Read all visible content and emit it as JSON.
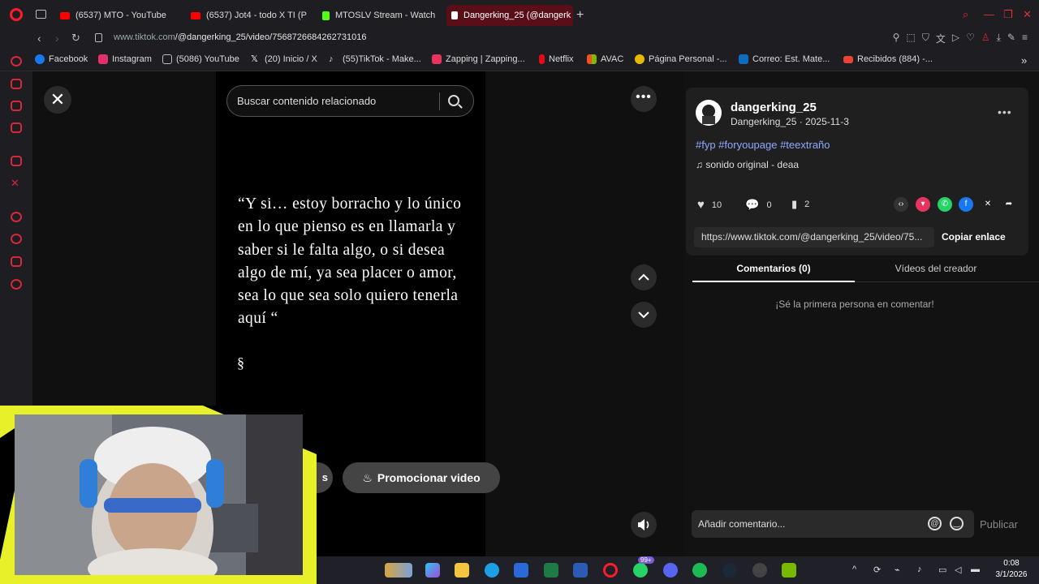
{
  "browser": {
    "tabs": [
      {
        "label": "(6537) MTO - YouTube",
        "color": "#ff0000"
      },
      {
        "label": "(6537) Jot4 - todo X TI (P",
        "color": "#ff0000"
      },
      {
        "label": "MTOSLV Stream - Watch L",
        "color": "#53fc18"
      },
      {
        "label": "Dangerking_25 (@dangerk",
        "color": "#ffffff"
      }
    ],
    "new_tab": "+",
    "url_host": "www.tiktok.com",
    "url_path": "/@dangerking_25/video/7568726684262731016"
  },
  "bookmarks": [
    {
      "label": "Facebook",
      "color": "#1877f2"
    },
    {
      "label": "Instagram",
      "color": "#e1306c"
    },
    {
      "label": "(5086) YouTube",
      "color": "#888888"
    },
    {
      "label": "(20) Inicio / X",
      "color": "#000000"
    },
    {
      "label": "(55)TikTok - Make...",
      "color": "#111111"
    },
    {
      "label": "Zapping | Zapping...",
      "color": "#e8335f"
    },
    {
      "label": "Netflix",
      "color": "#e50914"
    },
    {
      "label": "AVAC",
      "color": "#2c8bd9"
    },
    {
      "label": "Página Personal -...",
      "color": "#e6b800"
    },
    {
      "label": "Correo: Est. Mate...",
      "color": "#0f6cbd"
    },
    {
      "label": "Recibidos (884) -...",
      "color": "#ea4335"
    }
  ],
  "viewer": {
    "search_placeholder": "Buscar contenido relacionado",
    "quote": "“Y si… estoy borracho y lo único en lo que pienso es en llamarla y saber si le falta algo, o si desea algo de mí, ya sea placer o amor, sea lo que sea solo quiero tenerla aquí “",
    "symbol": "§",
    "promote_label": "Promocionar video",
    "prev_button_tail": "s"
  },
  "panel": {
    "username": "dangerking_25",
    "meta": "Dangerking_25 · 2025-11-3",
    "tags": "#fyp #foryoupage #teextraño",
    "music": "sonido original - deaa",
    "likes": "10",
    "comments": "0",
    "saves": "2",
    "link": "https://www.tiktok.com/@dangerking_25/video/75...",
    "copy_label": "Copiar enlace",
    "tab_comments": "Comentarios (0)",
    "tab_creator": "Vídeos del creador",
    "empty_text": "¡Sé la primera persona en comentar!",
    "comment_placeholder": "Añadir comentario...",
    "publish_label": "Publicar"
  },
  "taskbar": {
    "badge": "99+",
    "time": "0:08",
    "date": "3/1/2026"
  },
  "colors": {
    "accent": "#d6283a",
    "highlight": "#e8f02a",
    "link": "#8fa9ff"
  }
}
